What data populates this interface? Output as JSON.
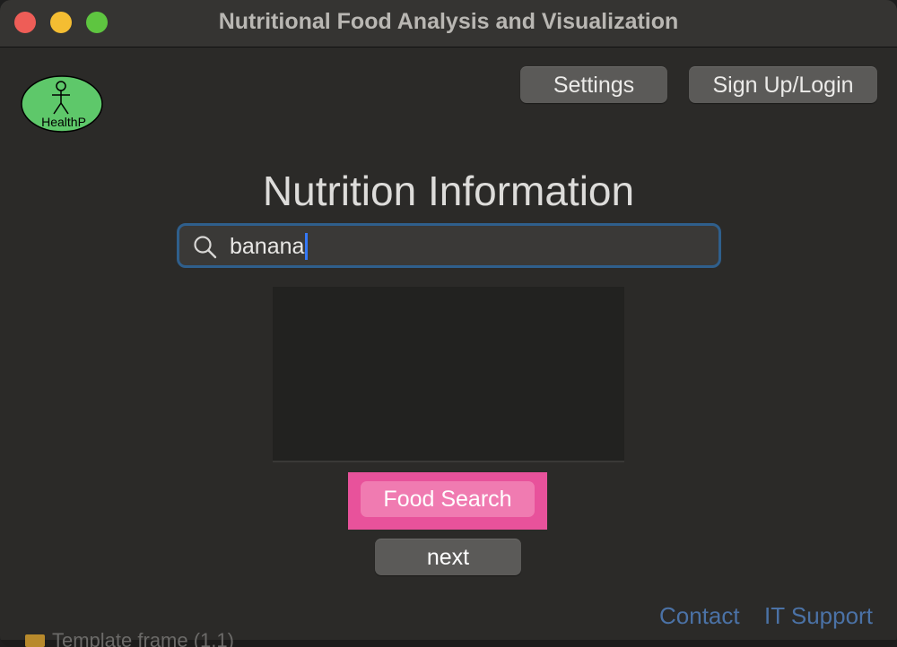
{
  "window": {
    "title": "Nutritional Food Analysis and Visualization"
  },
  "logo": {
    "text": "HealthP",
    "color": "#5ec86a"
  },
  "header": {
    "settings_label": "Settings",
    "signup_label": "Sign Up/Login"
  },
  "main": {
    "heading": "Nutrition Information",
    "search": {
      "value": "banana",
      "focus_color": "#2f5f8c"
    },
    "food_search_label": "Food Search",
    "next_label": "next"
  },
  "footer": {
    "contact_label": "Contact",
    "it_support_label": "IT Support"
  },
  "background_window": {
    "partial_text": "Template frame (1.1)"
  },
  "colors": {
    "highlight": "#e8529b",
    "food_button": "#f07bb1",
    "link": "#4b72a6"
  }
}
